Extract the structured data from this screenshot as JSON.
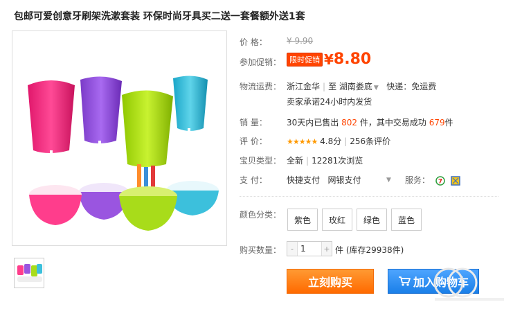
{
  "title": "包邮可爱创意牙刷架洗漱套装 环保时尚牙具买二送一套餐额外送1套",
  "price": {
    "label": "价      格：",
    "original": "¥ 9.90"
  },
  "promo": {
    "label": "参加促销：",
    "tag": "限时促销",
    "yen": "¥",
    "value": "8.80"
  },
  "shipping": {
    "label": "物流运费：",
    "from": "浙江金华",
    "to_prefix": "至",
    "to": "湖南娄底",
    "express": "快递：免运费",
    "promise": "卖家承诺24小时内发货"
  },
  "sales": {
    "label": "销      量：",
    "prefix": "30天内已售出",
    "count": "802",
    "mid": "件，其中交易成功",
    "success": "679",
    "suffix": "件"
  },
  "rating": {
    "label": "评      价：",
    "stars": "★★★★★",
    "score": "4.8分",
    "reviews": "256条评价"
  },
  "item_type": {
    "label": "宝贝类型：",
    "condition": "全新",
    "views": "12281次浏览"
  },
  "payment": {
    "label": "支      付：",
    "method1": "快捷支付",
    "method2": "网银支付",
    "service_label": "服务："
  },
  "colors": {
    "label": "颜色分类：",
    "options": [
      "紫色",
      "玫红",
      "绿色",
      "蓝色"
    ]
  },
  "quantity": {
    "label": "购买数量：",
    "minus": "-",
    "value": "1",
    "plus": "+",
    "stock": "件 (库存29938件)"
  },
  "buttons": {
    "buy": "立刻购买",
    "cart": "加入购物车"
  },
  "colors_hex": {
    "accent": "#ff4400",
    "buy": "#ff7a00",
    "cart": "#2b8ff0"
  }
}
